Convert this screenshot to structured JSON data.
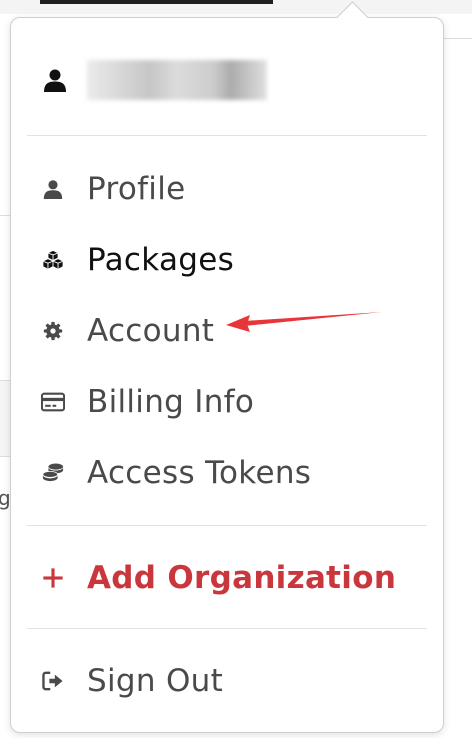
{
  "menu": {
    "user": {
      "name": ""
    },
    "items": [
      {
        "label": "Profile",
        "icon": "user-icon"
      },
      {
        "label": "Packages",
        "icon": "cubes-icon"
      },
      {
        "label": "Account",
        "icon": "gear-icon"
      },
      {
        "label": "Billing Info",
        "icon": "credit-card-icon"
      },
      {
        "label": "Access Tokens",
        "icon": "coins-icon"
      }
    ],
    "add_organization": {
      "label": "Add Organization",
      "icon": "plus-icon"
    },
    "sign_out": {
      "label": "Sign Out",
      "icon": "sign-out-icon"
    }
  },
  "colors": {
    "accent_red": "#c9373d",
    "text_gray": "#4a4a4a",
    "annotation_arrow": "#e8353a"
  },
  "background": {
    "fragment_text": "g"
  }
}
